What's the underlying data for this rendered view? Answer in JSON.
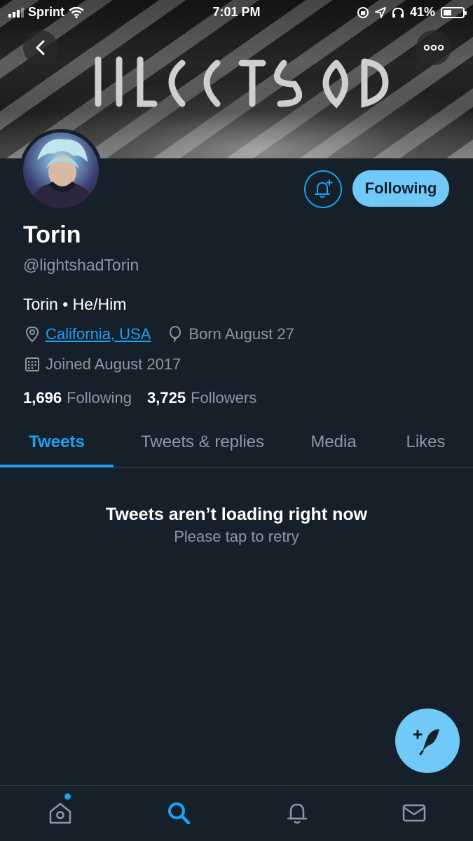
{
  "status_bar": {
    "carrier": "Sprint",
    "time": "7:01 PM",
    "battery_percent": "41%",
    "battery_level": 0.41
  },
  "banner": {
    "icons": [
      "chevron-left-icon",
      "more-horizontal-icon"
    ]
  },
  "profile": {
    "name": "Torin",
    "handle": "@lightshadTorin",
    "bio": "Torin • He/Him",
    "location": "California, USA",
    "birthday": "Born August 27",
    "joined": "Joined August 2017",
    "following_count": "1,696",
    "following_label": "Following",
    "followers_count": "3,725",
    "followers_label": "Followers"
  },
  "actions": {
    "following_button": "Following",
    "bell_icon": "bell-plus-icon"
  },
  "tabs": [
    {
      "label": "Tweets",
      "active": true
    },
    {
      "label": "Tweets & replies",
      "active": false
    },
    {
      "label": "Media",
      "active": false
    },
    {
      "label": "Likes",
      "active": false
    }
  ],
  "empty_state": {
    "title": "Tweets aren’t loading right now",
    "subtitle": "Please tap to retry"
  },
  "bottom_nav": [
    "home-icon",
    "search-icon",
    "notifications-icon",
    "messages-icon"
  ],
  "colors": {
    "background": "#15202b",
    "accent": "#1da1f2",
    "button_fill": "#71c9f8",
    "secondary_text": "#8899a6"
  }
}
